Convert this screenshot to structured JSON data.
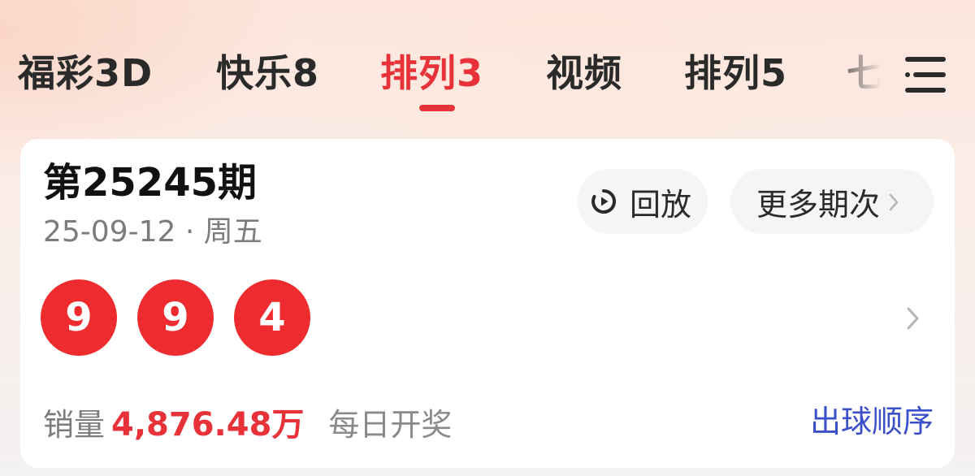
{
  "tabs": [
    {
      "label": "福彩3D",
      "active": false
    },
    {
      "label": "快乐8",
      "active": false
    },
    {
      "label": "排列3",
      "active": true
    },
    {
      "label": "视频",
      "active": false
    },
    {
      "label": "排列5",
      "active": false
    },
    {
      "label": "七",
      "active": false
    }
  ],
  "menu_icon": "hamburger-menu-icon",
  "card": {
    "issue_title": "第25245期",
    "date_line": "25-09-12 · 周五",
    "replay_label": "回放",
    "replay_icon": "replay-timer-icon",
    "more_issues_label": "更多期次",
    "balls": [
      "9",
      "9",
      "4"
    ],
    "sales_label": "销量",
    "sales_value": "4,876.48万",
    "draw_schedule": "每日开奖",
    "ball_order_link": "出球顺序"
  },
  "colors": {
    "accent_red": "#e8323a",
    "ball_red": "#ee2c2f",
    "link_blue": "#3b4fc8",
    "text_dark": "#2a2a2a",
    "text_gray": "#7c7c7c",
    "card_bg": "#ffffff"
  }
}
